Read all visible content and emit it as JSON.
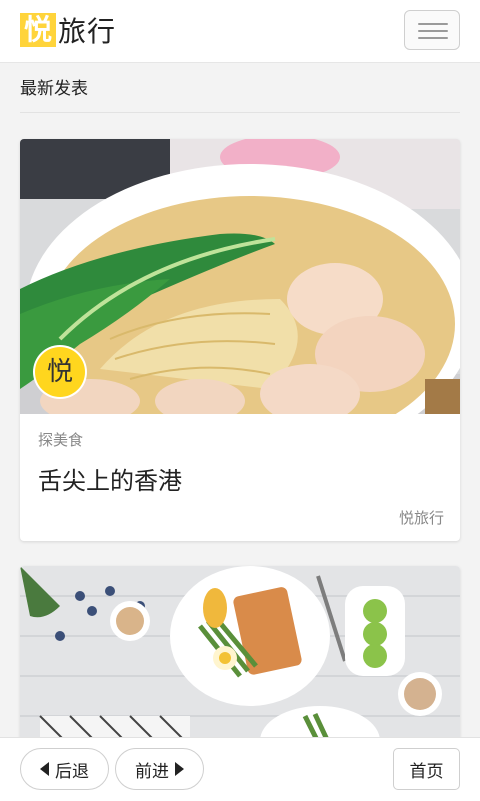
{
  "header": {
    "logo_mark": "悦",
    "logo_text": "旅行",
    "menu_icon": "hamburger-menu-icon"
  },
  "section": {
    "title": "最新发表"
  },
  "posts": [
    {
      "image": "noodle-soup-photo",
      "badge": "悦",
      "category": "探美食",
      "title": "舌尖上的香港",
      "author": "悦旅行"
    },
    {
      "image": "breakfast-table-photo"
    }
  ],
  "bottom_nav": {
    "back_label": "后退",
    "forward_label": "前进",
    "home_label": "首页",
    "back_icon": "chevron-left-icon",
    "forward_icon": "chevron-right-icon"
  },
  "colors": {
    "brand_yellow": "#ffd43b",
    "background": "#f3f3f3",
    "text_muted": "#888888"
  }
}
